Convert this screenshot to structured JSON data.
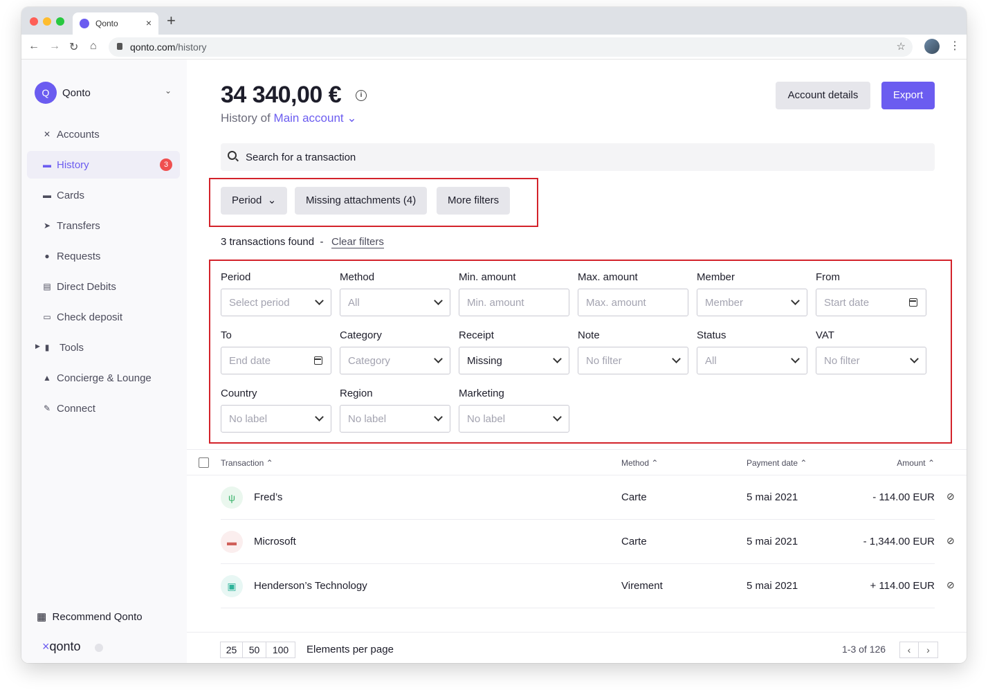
{
  "browser": {
    "tab_title": "Qonto",
    "url_host": "qonto.com",
    "url_path": "/history"
  },
  "sidebar": {
    "org_initial": "Q",
    "org_name": "Qonto",
    "items": [
      {
        "label": "Accounts",
        "icon": "accounts-icon"
      },
      {
        "label": "History",
        "icon": "history-icon",
        "badge": "3",
        "active": true
      },
      {
        "label": "Cards",
        "icon": "card-icon"
      },
      {
        "label": "Transfers",
        "icon": "transfer-icon"
      },
      {
        "label": "Requests",
        "icon": "request-icon"
      },
      {
        "label": "Direct Debits",
        "icon": "direct-debit-icon"
      },
      {
        "label": "Check deposit",
        "icon": "check-icon"
      },
      {
        "label": "Tools",
        "icon": "tools-icon"
      },
      {
        "label": "Concierge & Lounge",
        "icon": "concierge-icon"
      },
      {
        "label": "Connect",
        "icon": "connect-icon"
      }
    ],
    "recommend": "Recommend Qonto",
    "logo": "qonto"
  },
  "header": {
    "balance": "34 340,00 €",
    "history_of": "History of",
    "account": "Main account",
    "account_details_label": "Account details",
    "export_label": "Export"
  },
  "search": {
    "placeholder": "Search for a transaction"
  },
  "chips": {
    "period": "Period",
    "missing_attachments": "Missing attachments (4)",
    "more_filters": "More filters"
  },
  "results": {
    "found": "3 transactions found",
    "separator": "-",
    "clear_filters": "Clear filters"
  },
  "filters": {
    "period": {
      "label": "Period",
      "value": "Select period"
    },
    "method": {
      "label": "Method",
      "value": "All"
    },
    "min_amount": {
      "label": "Min. amount",
      "value": "Min. amount"
    },
    "max_amount": {
      "label": "Max. amount",
      "value": "Max. amount"
    },
    "member": {
      "label": "Member",
      "value": "Member"
    },
    "from": {
      "label": "From",
      "value": "Start date"
    },
    "to": {
      "label": "To",
      "value": "End date"
    },
    "category": {
      "label": "Category",
      "value": "Category"
    },
    "receipt": {
      "label": "Receipt",
      "value": "Missing"
    },
    "note": {
      "label": "Note",
      "value": "No filter"
    },
    "status": {
      "label": "Status",
      "value": "All"
    },
    "vat": {
      "label": "VAT",
      "value": "No filter"
    },
    "country": {
      "label": "Country",
      "value": "No label"
    },
    "region": {
      "label": "Region",
      "value": "No label"
    },
    "marketing": {
      "label": "Marketing",
      "value": "No label"
    }
  },
  "table": {
    "headers": {
      "transaction": "Transaction ⌃",
      "method": "Method ⌃",
      "date": "Payment date ⌃",
      "amount": "Amount ⌃"
    },
    "rows": [
      {
        "name": "Fred’s",
        "method": "Carte",
        "date": "5 mai 2021",
        "amount": "- 114.00 EUR",
        "icon": "restaurant-icon"
      },
      {
        "name": "Microsoft",
        "method": "Carte",
        "date": "5 mai 2021",
        "amount": "- 1,344.00 EUR",
        "icon": "computer-icon"
      },
      {
        "name": "Henderson’s Technology",
        "method": "Virement",
        "date": "5 mai 2021",
        "amount": "+ 114.00 EUR",
        "icon": "transfer-in-icon"
      }
    ]
  },
  "pagination": {
    "sizes": [
      "25",
      "50",
      "100"
    ],
    "label": "Elements per page",
    "range": "1-3 of 126"
  }
}
